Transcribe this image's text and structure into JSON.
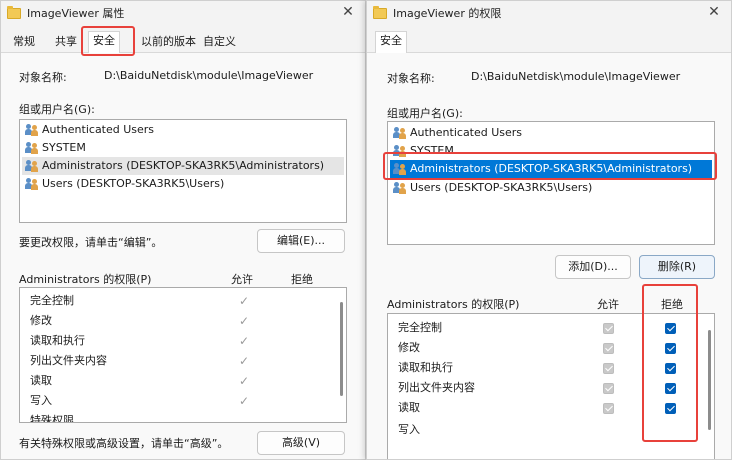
{
  "left_window": {
    "title": "ImageViewer 属性",
    "tabs": [
      "常规",
      "共享",
      "安全",
      "以前的版本",
      "自定义"
    ],
    "object_label": "对象名称:",
    "object_path": "D:\\BaiduNetdisk\\module\\ImageViewer",
    "group_label": "组或用户名(G):",
    "users": [
      "Authenticated Users",
      "SYSTEM",
      "Administrators (DESKTOP-SKA3RK5\\Administrators)",
      "Users (DESKTOP-SKA3RK5\\Users)"
    ],
    "change_hint": "要更改权限，请单击“编辑”。",
    "edit_button": "编辑(E)...",
    "perm_header": "Administrators 的权限(P)",
    "allow_col": "允许",
    "deny_col": "拒绝",
    "permissions": [
      "完全控制",
      "修改",
      "读取和执行",
      "列出文件夹内容",
      "读取",
      "写入",
      "特殊权限"
    ],
    "advanced_hint": "有关特殊权限或高级设置，请单击“高级”。",
    "advanced_button": "高级(V)",
    "check_glyph": "✓",
    "close_glyph": "✕"
  },
  "right_window": {
    "title": "ImageViewer 的权限",
    "tab": "安全",
    "object_label": "对象名称:",
    "object_path": "D:\\BaiduNetdisk\\module\\ImageViewer",
    "group_label": "组或用户名(G):",
    "users": [
      "Authenticated Users",
      "SYSTEM",
      "Administrators (DESKTOP-SKA3RK5\\Administrators)",
      "Users (DESKTOP-SKA3RK5\\Users)"
    ],
    "add_button": "添加(D)...",
    "remove_button": "删除(R)",
    "perm_header": "Administrators 的权限(P)",
    "allow_col": "允许",
    "deny_col": "拒绝",
    "permissions": [
      "完全控制",
      "修改",
      "读取和执行",
      "列出文件夹内容",
      "读取",
      "写入"
    ],
    "close_glyph": "✕"
  },
  "colors": {
    "highlight": "#e8413b",
    "selection": "#0078d7",
    "checkbox_on": "#005fb8"
  }
}
